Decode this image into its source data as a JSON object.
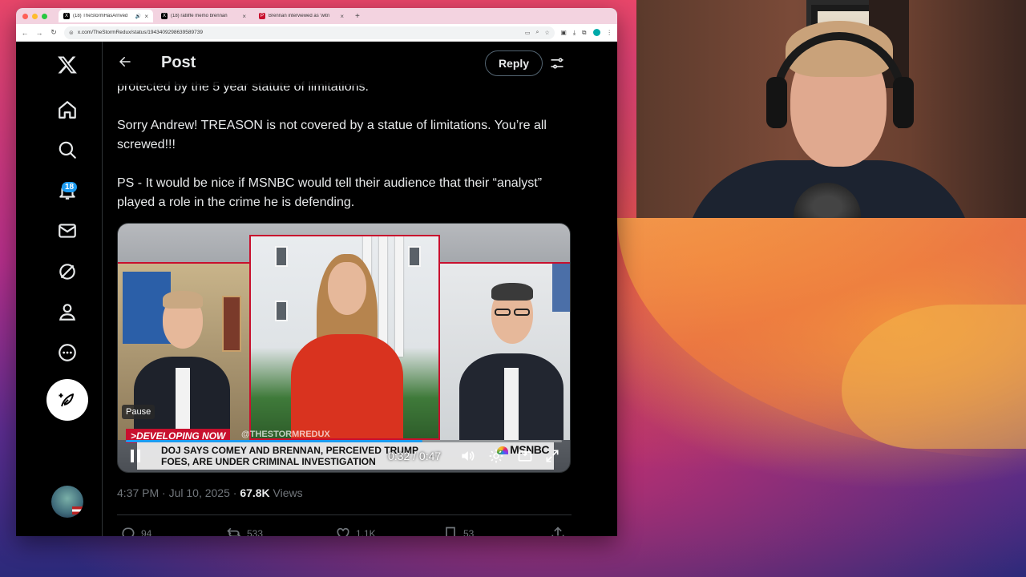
{
  "browser": {
    "tabs": [
      {
        "label": "(18) TheStormHasArrived",
        "favicon": "X",
        "active": true
      },
      {
        "label": "(18) ratliffe memo brennan",
        "favicon": "X",
        "active": false
      },
      {
        "label": "Brennan interviewed as 'witn",
        "favicon": "P",
        "active": false
      }
    ],
    "new_tab": "+",
    "url": "x.com/TheStormRedux/status/1943409298639589739"
  },
  "sidebar": {
    "notification_count": "18"
  },
  "header": {
    "title": "Post",
    "reply_label": "Reply"
  },
  "tweet": {
    "partial_line": "protected by the 5 year statute of limitations.",
    "paragraph1": "Sorry Andrew! TREASON is not covered by a statue of limitations. You’re all screwed!!!",
    "paragraph2": "PS - It would be nice if MSNBC would tell their audience that their “analyst” played a role in the  crime he is defending.",
    "timestamp": "4:37 PM · Jul 10, 2025 · ",
    "views_count": "67.8K",
    "views_label": " Views"
  },
  "video": {
    "developing_label": ">DEVELOPING NOW",
    "watermark": "@THESTORMREDUX",
    "headline_line1": "DOJ SAYS COMEY AND BRENNAN, PERCEIVED TRUMP",
    "headline_line2": "FOES, ARE UNDER CRIMINAL INVESTIGATION",
    "network": "MSNBC",
    "pause_tooltip": "Pause",
    "time": "0:32 / 0:47",
    "progress_fraction": 0.68
  },
  "actions": [
    {
      "name": "reply",
      "count": "94"
    },
    {
      "name": "repost",
      "count": "533"
    },
    {
      "name": "like",
      "count": "1.1K"
    },
    {
      "name": "bookmark",
      "count": "53"
    }
  ],
  "colors": {
    "accent": "#1d9bf0",
    "msnbc_red": "#c8102e"
  }
}
